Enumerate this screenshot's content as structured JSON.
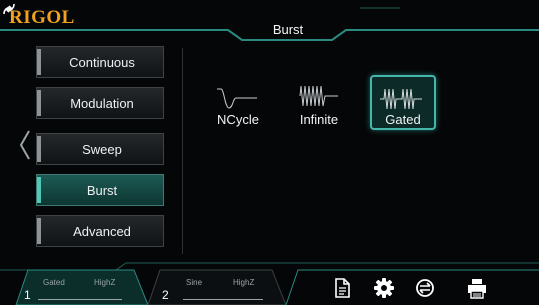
{
  "header": {
    "brand": "RIGOL",
    "title": "Burst",
    "icons": [
      "sync-arrows-icon"
    ]
  },
  "menu": {
    "items": [
      {
        "label": "Continuous",
        "selected": false
      },
      {
        "label": "Modulation",
        "selected": false
      },
      {
        "label": "Sweep",
        "selected": false
      },
      {
        "label": "Burst",
        "selected": true
      },
      {
        "label": "Advanced",
        "selected": false
      }
    ]
  },
  "burst_modes": [
    {
      "label": "NCycle",
      "icon": "ncycle-wave-icon",
      "selected": false
    },
    {
      "label": "Infinite",
      "icon": "infinite-wave-icon",
      "selected": false
    },
    {
      "label": "Gated",
      "icon": "gated-wave-icon",
      "selected": true
    }
  ],
  "channels": [
    {
      "number": "1",
      "wave": "Gated",
      "impedance": "HighZ",
      "active": true
    },
    {
      "number": "2",
      "wave": "Sine",
      "impedance": "HighZ",
      "active": false
    }
  ],
  "toolbar_icons": [
    "file-icon",
    "gear-icon",
    "utility-icon",
    "print-icon"
  ],
  "colors": {
    "brand": "#f0a11f",
    "accent": "#47b6aa",
    "selected_bg": "#1d5a54",
    "background": "#050608"
  }
}
